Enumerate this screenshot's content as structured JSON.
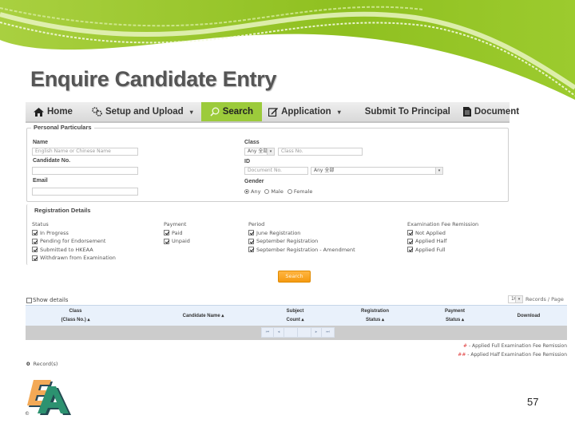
{
  "slide": {
    "title": "Enquire Candidate Entry",
    "page_number": "57",
    "logo_copyright": "©"
  },
  "colors": {
    "banner_green": "#8fc020",
    "nav_active": "#9ccb3b",
    "search_button": "#f59a10",
    "remission_mark": "#e04040"
  },
  "nav": {
    "items": [
      {
        "label": "Home",
        "icon": "home-icon"
      },
      {
        "label": "Setup and Upload",
        "icon": "settings-icon",
        "dropdown": "▾"
      },
      {
        "label": "Search",
        "icon": "search-icon",
        "active": true
      },
      {
        "label": "Application",
        "icon": "edit-icon",
        "dropdown": "▾"
      },
      {
        "label": "Submit To Principal"
      },
      {
        "label": "Document",
        "icon": "document-icon"
      }
    ]
  },
  "personal": {
    "legend": "Personal Particulars",
    "name_label": "Name",
    "name_placeholder": "English Name or Chinese Name",
    "candidate_no_label": "Candidate No.",
    "candidate_no_value": "",
    "email_label": "Email",
    "email_value": "",
    "class_label": "Class",
    "class_select": "Any 全部",
    "class_no_placeholder": "Class No.",
    "id_label": "ID",
    "document_no_placeholder": "Document No.",
    "id_type_select": "Any 全部",
    "gender_label": "Gender",
    "gender_options": [
      "Any",
      "Male",
      "Female"
    ],
    "gender_selected": "Any"
  },
  "registration": {
    "legend": "Registration Details",
    "status_title": "Status",
    "status": [
      {
        "label": "In Progress",
        "checked": true
      },
      {
        "label": "Pending for Endorsement",
        "checked": true
      },
      {
        "label": "Submitted to HKEAA",
        "checked": true
      },
      {
        "label": "Withdrawn from Examination",
        "checked": true
      }
    ],
    "payment_title": "Payment",
    "payment": [
      {
        "label": "Paid",
        "checked": true
      },
      {
        "label": "Unpaid",
        "checked": true
      }
    ],
    "period_title": "Period",
    "period": [
      {
        "label": "June Registration",
        "checked": true
      },
      {
        "label": "September Registration",
        "checked": true
      },
      {
        "label": "September Registration - Amendment",
        "checked": true
      }
    ],
    "remission_title": "Examination Fee Remission",
    "remission": [
      {
        "label": "Not Applied",
        "checked": true
      },
      {
        "label": "Applied Half",
        "checked": true
      },
      {
        "label": "Applied Full",
        "checked": true
      }
    ]
  },
  "actions": {
    "search_label": "Search",
    "show_details_label": "Show details",
    "show_details_checked": false
  },
  "table": {
    "records_per_page": "10",
    "records_per_page_label": "Records / Page",
    "columns": [
      {
        "line1": "Class",
        "line2": "(Class No.) ▴"
      },
      {
        "line1": "Candidate Name ▴",
        "line2": ""
      },
      {
        "line1": "Subject",
        "line2": "Count ▴"
      },
      {
        "line1": "Registration",
        "line2": "Status ▴"
      },
      {
        "line1": "Payment",
        "line2": "Status ▴"
      },
      {
        "line1": "Download",
        "line2": ""
      }
    ],
    "rows": [],
    "pager": [
      "⏮",
      "◂",
      "",
      "",
      "▸",
      "⏭"
    ],
    "record_count": "0",
    "record_label": "Record(s)"
  },
  "notes": [
    {
      "mark": "#",
      "text": " - Applied Full Examination Fee Remission"
    },
    {
      "mark": "##",
      "text": " - Applied Half Examination Fee Remission"
    }
  ]
}
